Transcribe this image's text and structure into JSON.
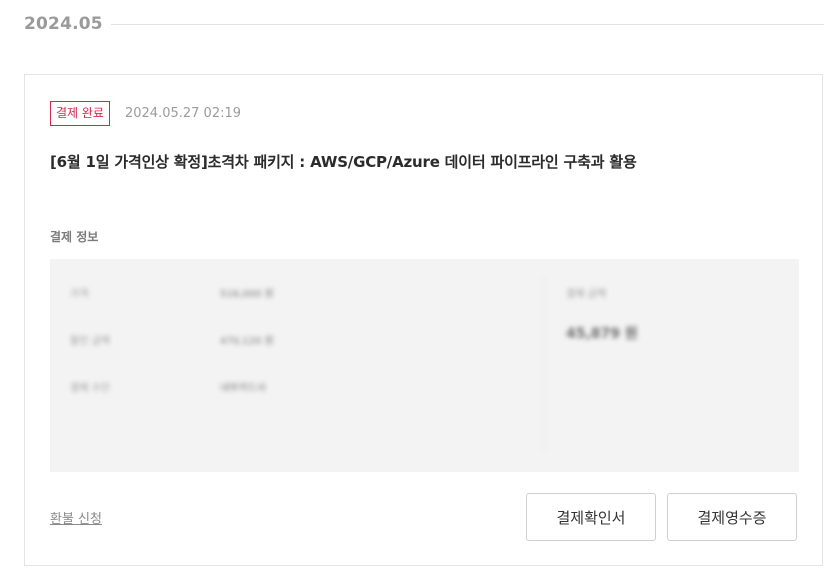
{
  "month": "2024.05",
  "order": {
    "status": "결제 완료",
    "date": "2024.05.27 02:19",
    "title": "[6월 1일 가격인상 확정]초격차 패키지 : AWS/GCP/Azure 데이터 파이프라인 구축과 활용"
  },
  "payment": {
    "section_title": "결제 정보",
    "rows": [
      {
        "key": "가격",
        "value": "516,000 원"
      },
      {
        "key": "할인 금액",
        "value": "470,120 원"
      },
      {
        "key": "결제 수단",
        "value": "내부카드사"
      }
    ],
    "total_label": "결제 금액",
    "total_value": "45,879 원"
  },
  "actions": {
    "refund_label": "환불 신청",
    "confirm_label": "결제확인서",
    "receipt_label": "결제영수증"
  },
  "colors": {
    "accent": "#d6284b",
    "muted": "#9b9b9b",
    "panel": "#f3f3f3"
  }
}
